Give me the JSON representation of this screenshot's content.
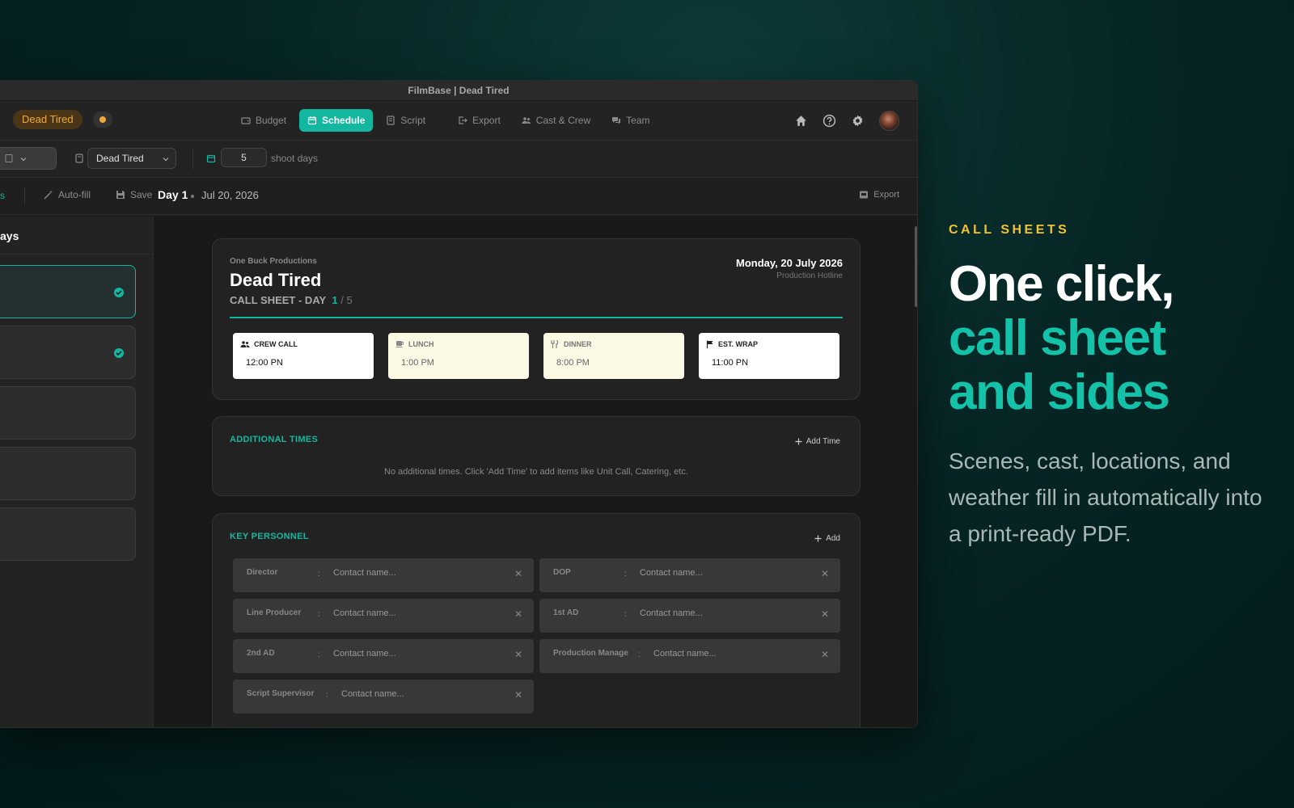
{
  "window": {
    "title": "FilmBase | Dead Tired"
  },
  "navbar": {
    "project_badge": "Dead Tired",
    "tabs": [
      {
        "label": "Budget",
        "icon": "wallet-icon",
        "active": false
      },
      {
        "label": "Schedule",
        "icon": "calendar-icon",
        "active": true
      },
      {
        "label": "Script",
        "icon": "script-icon",
        "active": false
      },
      {
        "label": "Export",
        "icon": "export-icon",
        "active": false
      },
      {
        "label": "Cast & Crew",
        "icon": "people-icon",
        "active": false
      },
      {
        "label": "Team",
        "icon": "chat-icon",
        "active": false
      }
    ]
  },
  "toolbar1": {
    "doc_select": "Dead Tired",
    "shoot_days_value": "5",
    "shoot_days_label": "shoot days"
  },
  "toolbar2": {
    "left_partial": "s",
    "autofill": "Auto-fill",
    "save": "Save",
    "day_title": "Day 1",
    "day_date": "Jul 20, 2026",
    "export": "Export"
  },
  "sidebar": {
    "title_partial": "ays",
    "day_cards": [
      {
        "active": true,
        "done": true
      },
      {
        "active": false,
        "done": true
      },
      {
        "active": false,
        "done": false
      },
      {
        "active": false,
        "done": false
      },
      {
        "active": false,
        "done": false
      }
    ]
  },
  "call_sheet": {
    "production_company": "One Buck Productions",
    "project_title": "Dead Tired",
    "sheet_label": "CALL SHEET - DAY",
    "day_current": "1",
    "day_separator": "/",
    "day_total": "5",
    "date": "Monday, 20 July 2026",
    "hotline_label": "Production Hotline",
    "times": [
      {
        "label": "CREW CALL",
        "value": "12:00 PN",
        "style": "white",
        "icon": "people-icon"
      },
      {
        "label": "LUNCH",
        "value": "1:00 PM",
        "style": "cream",
        "icon": "coffee-icon"
      },
      {
        "label": "DINNER",
        "value": "8:00 PM",
        "style": "cream",
        "icon": "utensils-icon"
      },
      {
        "label": "EST. WRAP",
        "value": "11:00 PN",
        "style": "white",
        "icon": "flag-icon"
      }
    ]
  },
  "additional_times": {
    "title": "ADDITIONAL TIMES",
    "action": "Add Time",
    "empty_message": "No additional times. Click 'Add Time' to add items like Unit Call, Catering, etc."
  },
  "key_personnel": {
    "title": "KEY PERSONNEL",
    "action": "Add",
    "colon": ":",
    "placeholder": "Contact name...",
    "roles": [
      "Director",
      "DOP",
      "Line Producer",
      "1st AD",
      "2nd AD",
      "Production Manage",
      "Script Supervisor"
    ]
  },
  "hero": {
    "eyebrow": "CALL SHEETS",
    "headline_line1": "One click,",
    "headline_line2": "call sheet",
    "headline_line3": "and sides",
    "subtext": "Scenes, cast, locations, and weather fill in automatically into a print-ready PDF."
  },
  "colors": {
    "accent": "#13b7a0",
    "project_badge_bg": "#4a3616",
    "project_badge_text": "#f2a838",
    "eyebrow": "#f2c230"
  }
}
